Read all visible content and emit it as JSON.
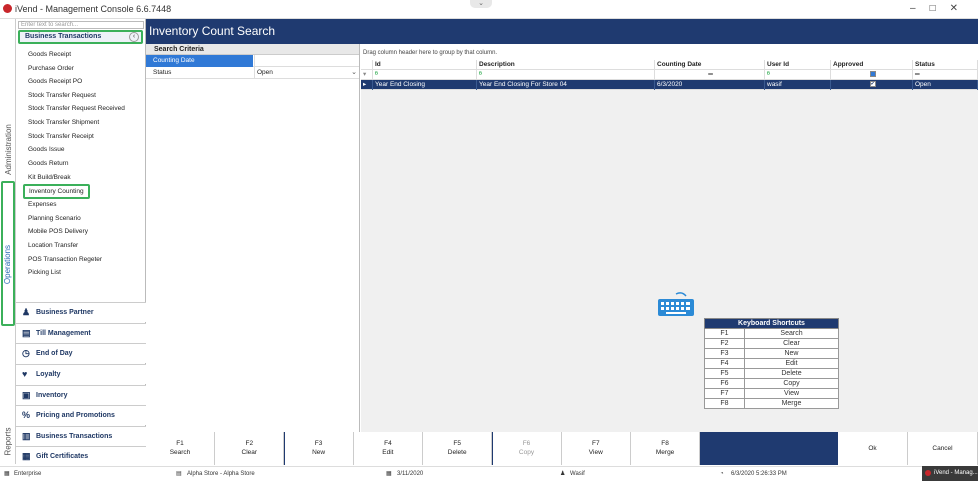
{
  "window": {
    "title": "iVend - Management Console  6.6.7448"
  },
  "left_tabs": [
    "Administration",
    "Operations",
    "Reports"
  ],
  "nav": {
    "search_placeholder": "Enter text to search...",
    "section_title": "Business Transactions",
    "items": [
      "Goods Receipt",
      "Purchase Order",
      "Goods Receipt PO",
      "Stock Transfer Request",
      "Stock Transfer Request Received",
      "Stock Transfer Shipment",
      "Stock Transfer Receipt",
      "Goods Issue",
      "Goods Return",
      "Kit Build/Break",
      "Inventory Counting",
      "Expenses",
      "Planning Scenario",
      "Mobile POS Delivery",
      "Location Transfer",
      "POS Transaction Regeter",
      "Picking List"
    ],
    "main_sections": [
      "Business Partner",
      "Till Management",
      "End of Day",
      "Loyalty",
      "Inventory",
      "Pricing and Promotions",
      "Business Transactions",
      "Gift Certificates"
    ]
  },
  "page": {
    "title": "Inventory Count Search"
  },
  "criteria": {
    "header": "Search Criteria",
    "rows": [
      {
        "label": "Counting Date",
        "value": ""
      },
      {
        "label": "Status",
        "value": "Open"
      }
    ]
  },
  "grid": {
    "group_hint": "Drag column header here to group by that column.",
    "columns": [
      "Id",
      "Description",
      "Counting Date",
      "User Id",
      "Approved",
      "Status"
    ],
    "rows": [
      {
        "id": "Year End Closing",
        "description": "Year End Closing For Store 04",
        "counting_date": "6/3/2020",
        "user_id": "wasif",
        "approved": true,
        "status": "Open"
      }
    ]
  },
  "shortcuts": {
    "title": "Keyboard Shortcuts",
    "items": [
      {
        "key": "F1",
        "action": "Search"
      },
      {
        "key": "F2",
        "action": "Clear"
      },
      {
        "key": "F3",
        "action": "New"
      },
      {
        "key": "F4",
        "action": "Edit"
      },
      {
        "key": "F5",
        "action": "Delete"
      },
      {
        "key": "F6",
        "action": "Copy"
      },
      {
        "key": "F7",
        "action": "View"
      },
      {
        "key": "F8",
        "action": "Merge"
      }
    ]
  },
  "fkeys": [
    {
      "key": "F1",
      "label": "Search",
      "enabled": true
    },
    {
      "key": "F2",
      "label": "Clear",
      "enabled": true
    },
    {
      "key": "F3",
      "label": "New",
      "enabled": true
    },
    {
      "key": "F4",
      "label": "Edit",
      "enabled": true
    },
    {
      "key": "F5",
      "label": "Delete",
      "enabled": true
    },
    {
      "key": "F6",
      "label": "Copy",
      "enabled": false
    },
    {
      "key": "F7",
      "label": "View",
      "enabled": true
    },
    {
      "key": "F8",
      "label": "Merge",
      "enabled": true
    }
  ],
  "actions": {
    "ok": "Ok",
    "cancel": "Cancel"
  },
  "status_bar": {
    "company": "Enterprise",
    "store": "Alpha Store - Alpha Store",
    "date": "3/11/2020",
    "user": "Wasif",
    "datetime": "6/3/2020 5:26:33 PM",
    "taskbar": "iVend - Manag..."
  },
  "colors": {
    "brand": "#1f3a70",
    "highlight": "#3bb05a",
    "selection": "#3079d6"
  }
}
